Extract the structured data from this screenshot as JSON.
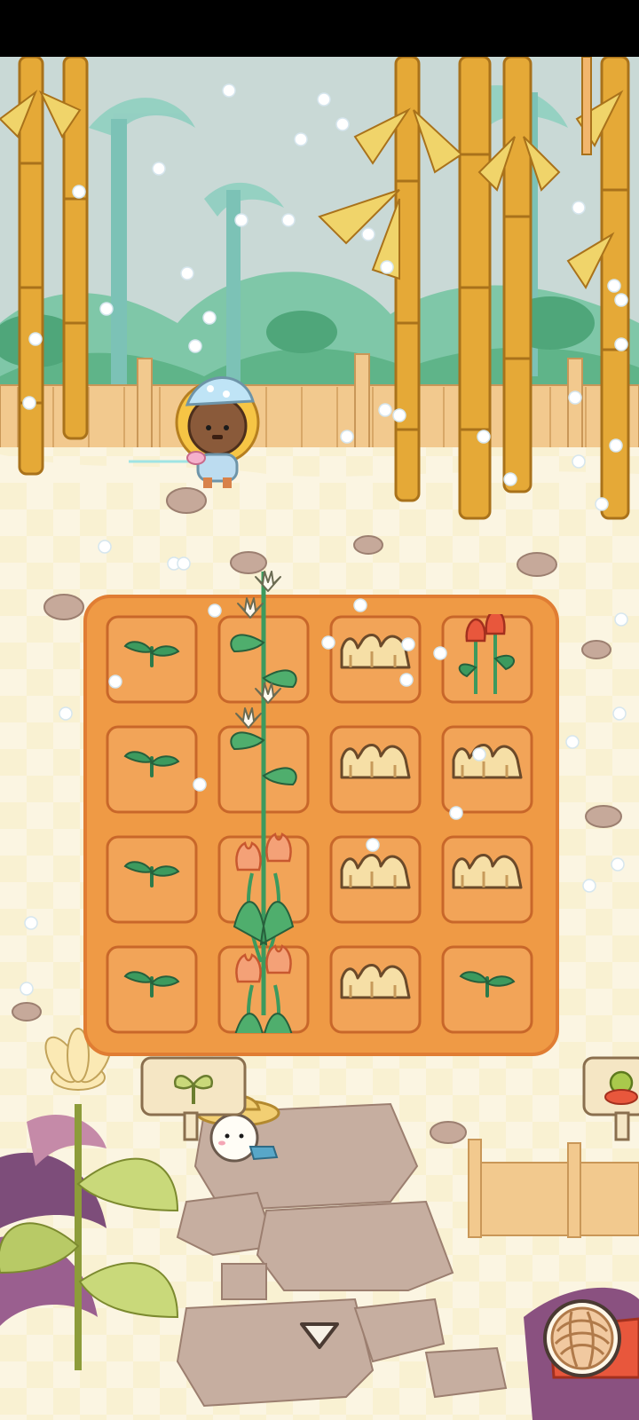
{
  "game": {
    "scene": "garden",
    "plots": [
      [
        "sprout",
        "lily",
        "mushroom",
        "rose"
      ],
      [
        "sprout",
        "lily",
        "mushroom",
        "mushroom"
      ],
      [
        "sprout",
        "tulip",
        "mushroom",
        "mushroom"
      ],
      [
        "sprout",
        "tulip",
        "mushroom",
        "sprout"
      ]
    ],
    "icons": {
      "plot_sign": "seedling-icon",
      "nav_toggle": "chevron-down-icon",
      "yarn_button": "yarn-ball-icon"
    },
    "colors": {
      "soil": "#ef9a45",
      "plot_border": "#e07d33",
      "sky": "#c9d9d6",
      "bamboo": "#e5a937",
      "fence": "#f2c98e",
      "accent_red": "#e8573c"
    }
  }
}
